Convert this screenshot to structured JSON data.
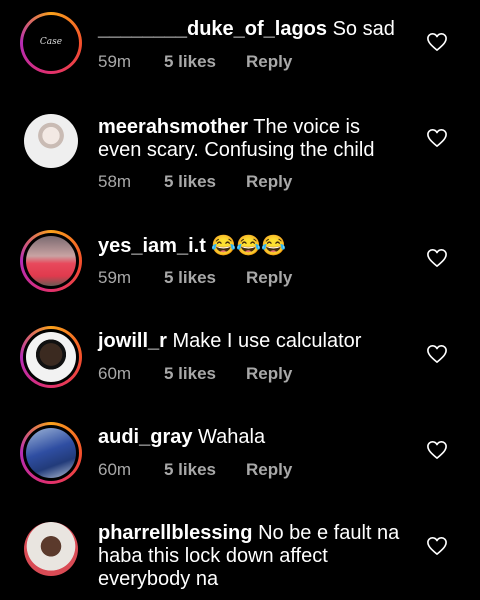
{
  "comments": [
    {
      "username": "________duke_of_lagos",
      "text": "So sad",
      "time": "59m",
      "likes": "5 likes",
      "reply": "Reply",
      "avatar": "logo-avatar",
      "avatar_text": "Case",
      "story_ring": true
    },
    {
      "username": "meerahsmother",
      "text": "The voice is even scary. Confusing the child",
      "time": "58m",
      "likes": "5 likes",
      "reply": "Reply",
      "avatar": "child-photo",
      "story_ring": false
    },
    {
      "username": "yes_iam_i.t",
      "text": "😂😂😂",
      "time": "59m",
      "likes": "5 likes",
      "reply": "Reply",
      "avatar": "woman-in-red-photo",
      "story_ring": true
    },
    {
      "username": "jowill_r",
      "text": "Make I use calculator",
      "time": "60m",
      "likes": "5 likes",
      "reply": "Reply",
      "avatar": "man-portrait-photo",
      "story_ring": true
    },
    {
      "username": "audi_gray",
      "text": "Wahala",
      "time": "60m",
      "likes": "5 likes",
      "reply": "Reply",
      "avatar": "person-blue-photo",
      "story_ring": true
    },
    {
      "username": "pharrellblessing",
      "text": "No be e fault na haba this lock down affect everybody na",
      "time": "",
      "likes": "",
      "reply": "",
      "avatar": "woman-standing-photo",
      "story_ring": false
    }
  ],
  "icons": {
    "like": "heart-outline-icon"
  },
  "colors": {
    "background": "#000000",
    "text": "#ffffff",
    "secondary": "#a8a8a8"
  }
}
